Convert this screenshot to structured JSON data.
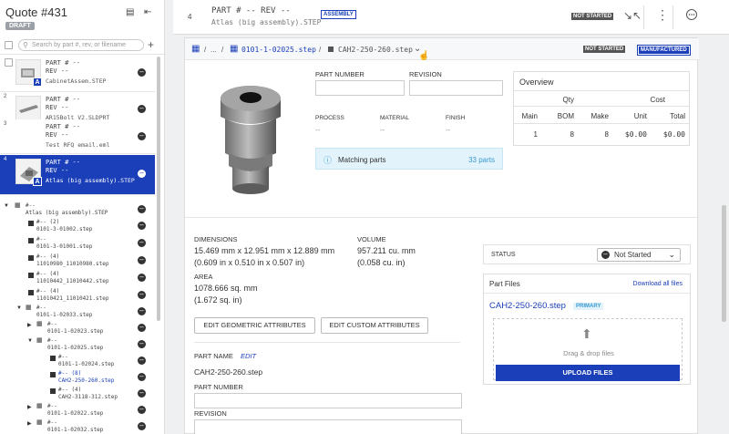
{
  "sidebar": {
    "quote_title": "Quote #431",
    "status_badge": "DRAFT",
    "search_placeholder": "Search by part #, rev, or filename",
    "parts": [
      {
        "num": "1",
        "part_line": "PART #  --",
        "rev_line": "REV    --",
        "filename": "CabinetAssem.STEP",
        "assembly": true
      },
      {
        "num": "2",
        "part_line": "PART #  --",
        "rev_line": "REV    --",
        "filename": "AR15Bolt_V2.SLDPRT",
        "assembly": false
      },
      {
        "num": "3",
        "part_line": "PART #  --",
        "rev_line": "REV    --",
        "filename": "Test RFQ email.eml",
        "assembly": false
      },
      {
        "num": "4",
        "part_line": "PART #  --",
        "rev_line": "REV    --",
        "filename": "Atlas (big assembly).STEP",
        "assembly": true
      }
    ],
    "tree": [
      {
        "l1": "#--",
        "l2": "Atlas (big assembly).STEP"
      },
      {
        "l1": "#-- (2)",
        "l2": "0101-3-01002.step"
      },
      {
        "l1": "#--",
        "l2": "0101-3-01001.step"
      },
      {
        "l1": "#-- (4)",
        "l2": "11010980_11010980.step"
      },
      {
        "l1": "#-- (4)",
        "l2": "11010442_11010442.step"
      },
      {
        "l1": "#-- (4)",
        "l2": "11010421_11010421.step"
      },
      {
        "l1": "#--",
        "l2": "0101-1-02033.step"
      },
      {
        "l1": "#--",
        "l2": "0101-1-02023.step"
      },
      {
        "l1": "#--",
        "l2": "0101-1-02025.step"
      },
      {
        "l1": "#--",
        "l2": "0101-1-02024.step"
      },
      {
        "l1": "#-- (8)",
        "l2": "CAH2-250-260.step"
      },
      {
        "l1": "#-- (4)",
        "l2": "CAH2-3118-312.step"
      },
      {
        "l1": "#--",
        "l2": "0101-1-02022.step"
      },
      {
        "l1": "#--",
        "l2": "0101-1-02032.step"
      }
    ]
  },
  "topbar": {
    "row_num": "4",
    "part_line": "PART # --  REV --",
    "filename": "Atlas (big assembly).STEP",
    "assembly_badge": "ASSEMBLY",
    "status_badge": "NOT STARTED"
  },
  "breadcrumb": {
    "ellipsis": "...",
    "parent": "0101-1-02025.step",
    "current": "CAH2-250-260.step",
    "status_badge": "NOT STARTED",
    "type_badge": "MANUFACTURED"
  },
  "fields": {
    "part_number_label": "PART NUMBER",
    "revision_label": "REVISION",
    "process_label": "PROCESS",
    "material_label": "MATERIAL",
    "finish_label": "FINISH",
    "process_value": "--",
    "material_value": "--",
    "finish_value": "--"
  },
  "matching": {
    "label": "Matching parts",
    "count": "33 parts"
  },
  "overview": {
    "title": "Overview",
    "qty_header": "Qty",
    "cost_header": "Cost",
    "cols": [
      "Main",
      "BOM",
      "Make",
      "Unit",
      "Total"
    ],
    "values": [
      "1",
      "8",
      "8",
      "$0.00",
      "$0.00"
    ]
  },
  "geometry": {
    "dimensions_label": "DIMENSIONS",
    "dimensions_mm": "15.469 mm x 12.951 mm x 12.889 mm",
    "dimensions_in": "(0.609 in x 0.510 in x 0.507 in)",
    "volume_label": "VOLUME",
    "volume_mm": "957.211 cu. mm",
    "volume_in": "(0.058 cu. in)",
    "area_label": "AREA",
    "area_mm": "1078.666 sq. mm",
    "area_in": "(1.672 sq. in)",
    "edit_geo_button": "EDIT GEOMETRIC ATTRIBUTES",
    "edit_custom_button": "EDIT CUSTOM ATTRIBUTES"
  },
  "status": {
    "label": "STATUS",
    "value": "Not Started"
  },
  "files": {
    "title": "Part Files",
    "download_all": "Download all files",
    "file_name": "CAH2-250-260.step",
    "primary_badge": "PRIMARY",
    "drop_text": "Drag & drop files",
    "upload_button": "UPLOAD FILES"
  },
  "part_name": {
    "label": "PART NAME",
    "edit": "EDIT",
    "value": "CAH2-250-260.step",
    "part_number_label": "PART NUMBER",
    "revision_label": "REVISION"
  },
  "colors": {
    "accent": "#1a3fb8",
    "info": "#3a9ad1",
    "badge_gray": "#555555"
  }
}
